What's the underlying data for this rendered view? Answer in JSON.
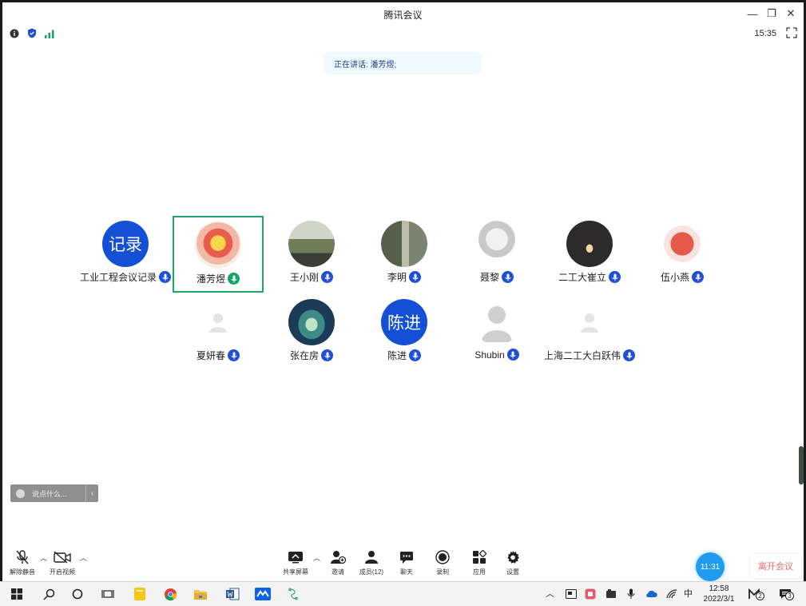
{
  "window": {
    "title": "腾讯会议",
    "clock": "15:35"
  },
  "speaking": {
    "label": "正在讲话: 潘芳煜;"
  },
  "participants": [
    {
      "name": "工业工程会议记录",
      "avatar_text": "记录",
      "avatar_type": "text-blue",
      "mic": "blue"
    },
    {
      "name": "潘芳煜",
      "avatar_type": "photo",
      "mic": "green",
      "active": true
    },
    {
      "name": "王小刚",
      "avatar_type": "photo",
      "mic": "blue"
    },
    {
      "name": "李明",
      "avatar_type": "photo",
      "mic": "blue"
    },
    {
      "name": "聂黎",
      "avatar_type": "photo",
      "mic": "blue"
    },
    {
      "name": "二工大崔立",
      "avatar_type": "photo",
      "mic": "blue"
    },
    {
      "name": "伍小燕",
      "avatar_type": "photo",
      "mic": "blue"
    },
    {
      "name": "夏妍春",
      "avatar_type": "default",
      "mic": "blue"
    },
    {
      "name": "张在房",
      "avatar_type": "photo",
      "mic": "blue"
    },
    {
      "name": "陈进",
      "avatar_text": "陈进",
      "avatar_type": "text-blue",
      "mic": "blue"
    },
    {
      "name": "Shubin",
      "avatar_type": "default-gray",
      "mic": "blue"
    },
    {
      "name": "上海二工大白跃伟",
      "avatar_type": "default",
      "mic": "blue"
    }
  ],
  "chat": {
    "placeholder": "说点什么..."
  },
  "toolbar": {
    "unmute": "解除静音",
    "video": "开启视频",
    "share": "共享屏幕",
    "invite": "邀请",
    "members": "成员(12)",
    "chat": "聊天",
    "record": "录制",
    "apps": "应用",
    "settings": "设置",
    "float_time": "11:31",
    "leave": "离开会议"
  },
  "taskbar": {
    "ime": "中",
    "time": "12:58",
    "date": "2022/3/1",
    "badge_a": "2",
    "badge_b": "3"
  },
  "colors": {
    "accent": "#1f4fd6",
    "active": "#20a56b",
    "leave": "#e66d6d"
  }
}
